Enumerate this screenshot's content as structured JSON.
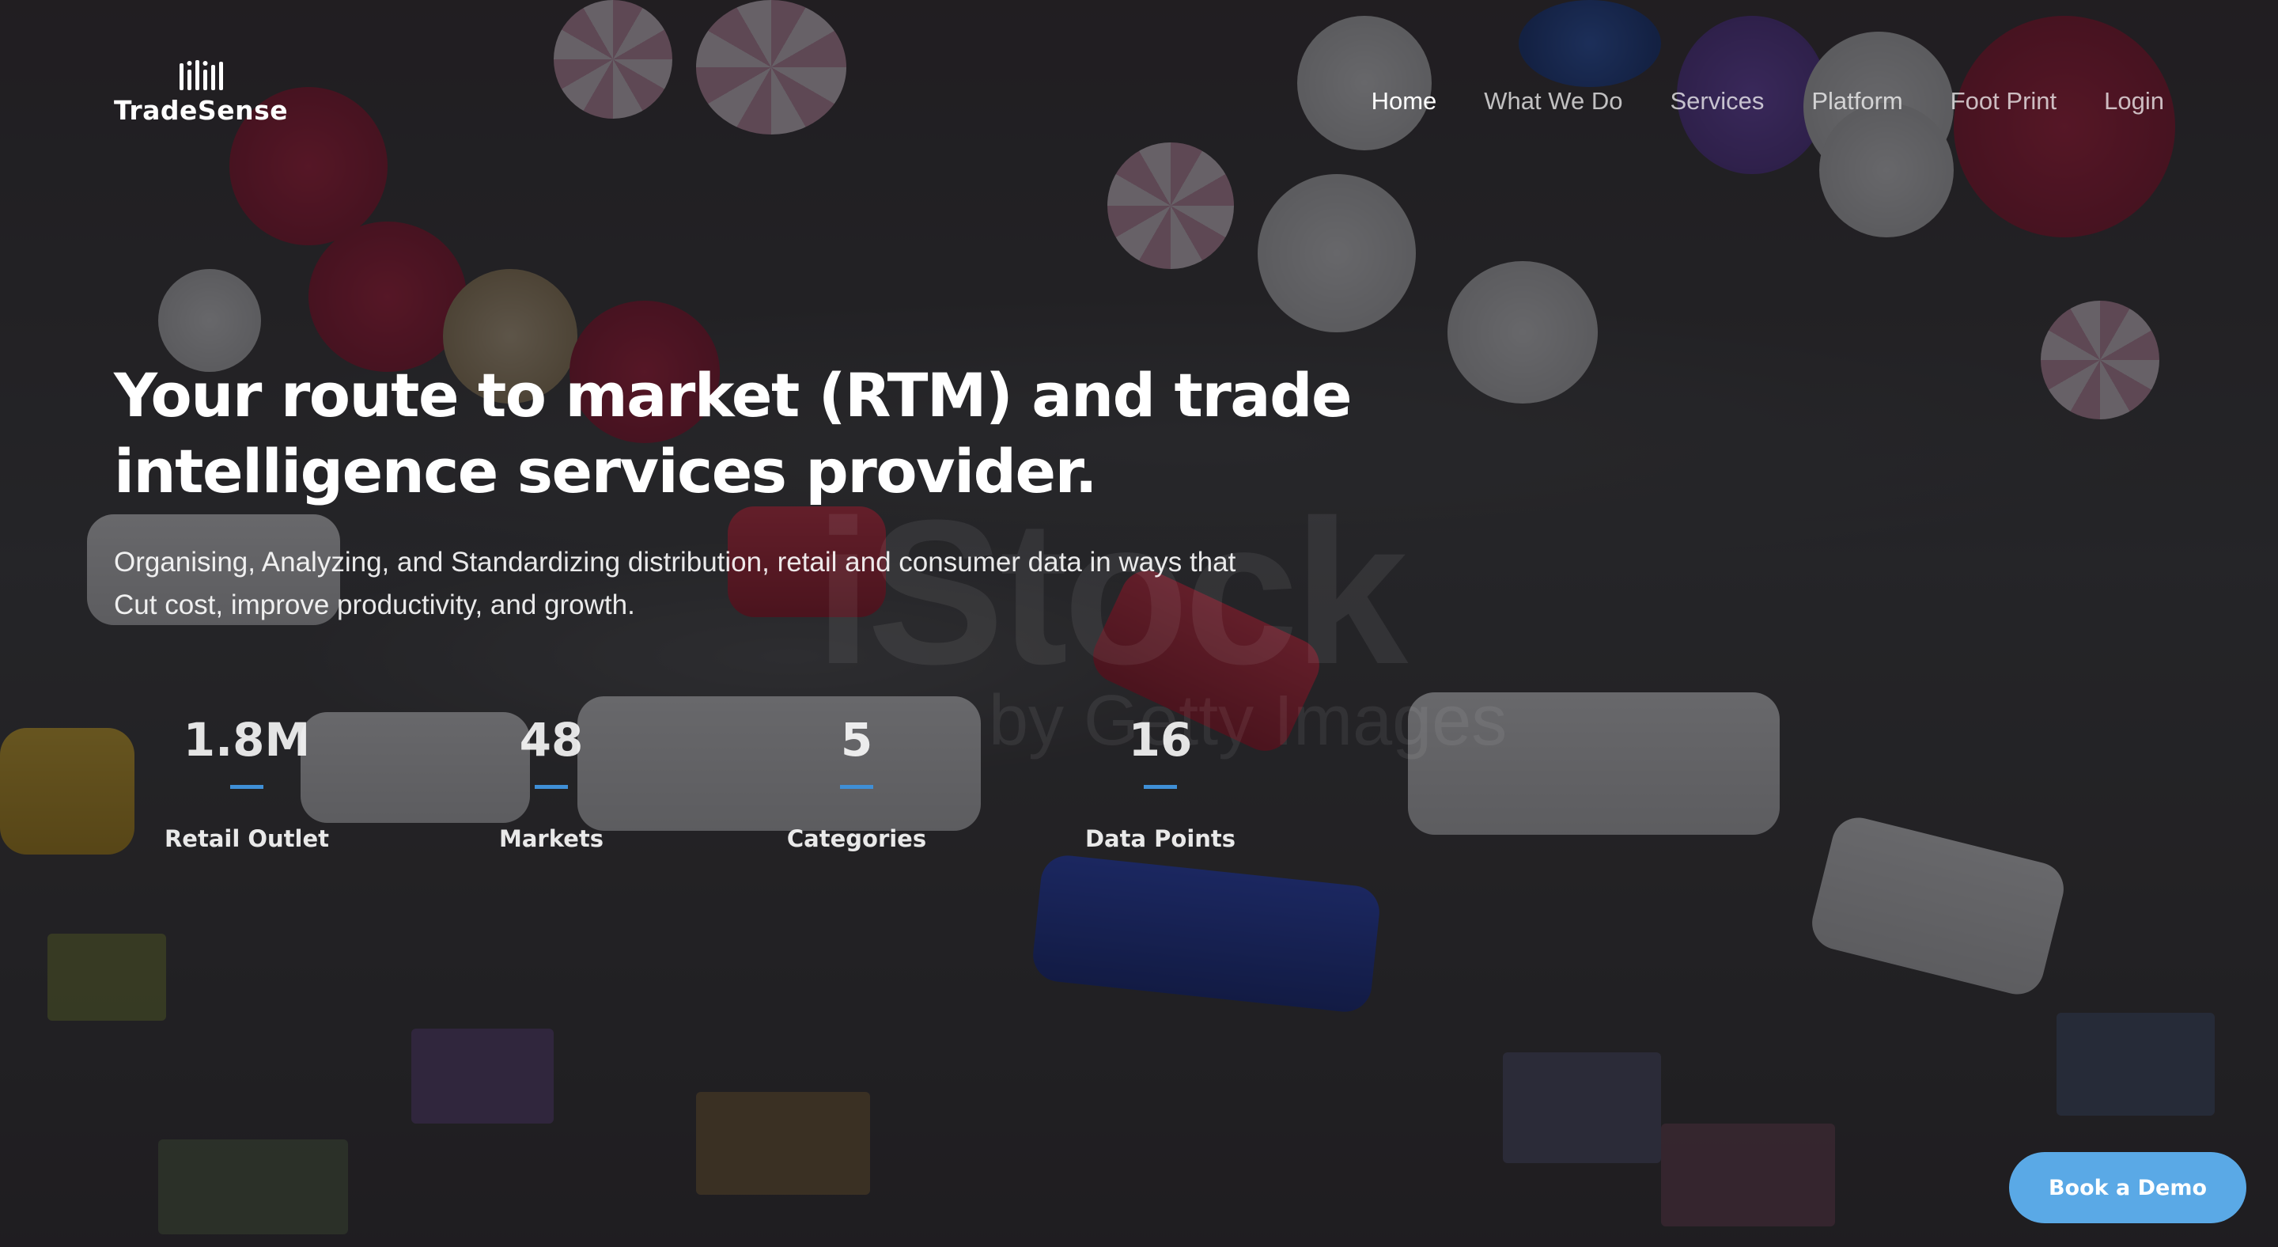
{
  "brand": {
    "name": "TradeSense",
    "logo_icon": "bar-chart-logo-icon"
  },
  "nav": {
    "items": [
      {
        "label": "Home",
        "active": true
      },
      {
        "label": "What We Do",
        "active": false
      },
      {
        "label": "Services",
        "active": false
      },
      {
        "label": "Platform",
        "active": false
      },
      {
        "label": "Foot Print",
        "active": false
      },
      {
        "label": "Login",
        "active": false
      }
    ]
  },
  "hero": {
    "title_line1": "Your route to market (RTM) and trade",
    "title_line2": "intelligence services provider.",
    "subtitle_line1": "Organising, Analyzing, and Standardizing distribution, retail and consumer data in ways that",
    "subtitle_line2": "Cut cost, improve productivity, and growth."
  },
  "stats": [
    {
      "value": "1.8M",
      "label": "Retail Outlet"
    },
    {
      "value": "48",
      "label": "Markets"
    },
    {
      "value": "5",
      "label": "Categories"
    },
    {
      "value": "16",
      "label": "Data Points"
    }
  ],
  "watermark": {
    "main": "iStock",
    "sub": "by Getty Images"
  },
  "cta": {
    "label": "Book a Demo"
  },
  "colors": {
    "accent": "#5aa9e6",
    "stat_rule": "#3f8fd6",
    "overlay": "#121216"
  }
}
